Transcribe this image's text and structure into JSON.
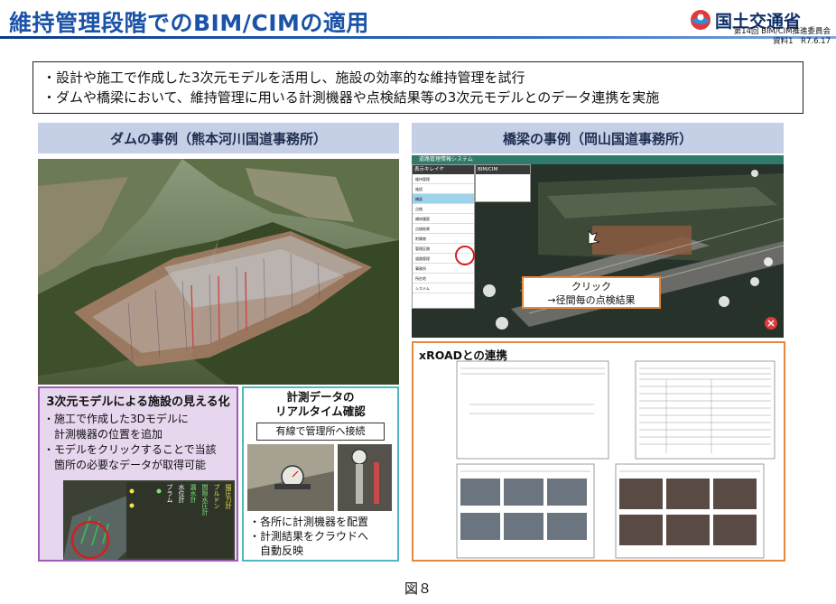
{
  "header": {
    "title": "維持管理段階でのBIM/CIMの適用",
    "org_name": "国土交通省",
    "meeting": "第14回 BIM/CIM推進委員会",
    "material": "資料1　R7.6.17"
  },
  "bullets": [
    "・設計や施工で作成した3次元モデルを活用し、施設の効率的な維持管理を試行",
    "・ダムや橋梁において、維持管理に用いる計測機器や点検結果等の3次元モデルとのデータ連携を実施"
  ],
  "dam": {
    "heading": "ダムの事例（熊本河川国道事務所）",
    "box1": {
      "title": "3次元モデルによる施設の見える化",
      "lines": [
        "・施工で作成した3Dモデルに",
        "　計測機器の位置を追加",
        "・モデルをクリックすることで当該",
        "　箇所の必要なデータが取得可能"
      ],
      "callout_labels": [
        "揚圧力計",
        "ブルドン",
        "間隙水圧計",
        "漏水計",
        "水位計",
        "プラム"
      ]
    },
    "box2": {
      "title_line1": "計測データの",
      "title_line2": "リアルタイム確認",
      "tag": "有線で管理所へ接続",
      "lines": [
        "・各所に計測機器を配置",
        "・計測結果をクラウドへ",
        "　自動反映"
      ]
    }
  },
  "bridge": {
    "heading": "橋梁の事例（岡山国道事務所）",
    "system_title": "道路管理情報システム",
    "menu_header": "表示キレイヤ",
    "menu_tab": "BIM/CIM",
    "menu_items": [
      "維持管理",
      "施設",
      "橋梁",
      "点検",
      "補修履歴",
      "点検結果",
      "附属物",
      "管理区間",
      "道路管理",
      "事務所",
      "所在地",
      "システム"
    ],
    "callout_line1": "クリック",
    "callout_line2": "→径間毎の点検結果",
    "xroad_title": "xROADとの連携"
  },
  "figure_caption": "図８",
  "colors": {
    "title_blue": "#1b53a8",
    "section_header_bg": "#c5d0e6",
    "box1_border": "#a05cb4",
    "box2_border": "#4fb8c0",
    "xroad_border": "#e5893a",
    "callout_border": "#e5893a",
    "marker_red": "#d02020"
  }
}
